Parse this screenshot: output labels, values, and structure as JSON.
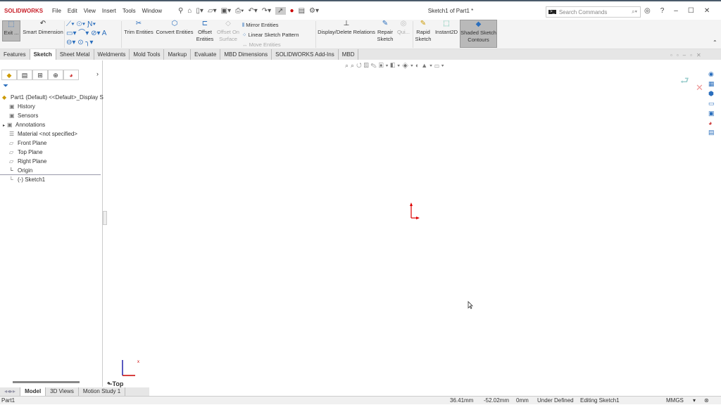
{
  "app": {
    "logo": "SOLIDWORKS",
    "title": "Sketch1 of Part1 *"
  },
  "menu": [
    "File",
    "Edit",
    "View",
    "Insert",
    "Tools",
    "Window"
  ],
  "search": {
    "placeholder": "Search Commands"
  },
  "ribbon": {
    "exit": "Exit ...",
    "smart_dimension": "Smart Dimension",
    "trim": "Trim Entities",
    "convert": "Convert Entities",
    "offset": "Offset Entities",
    "offset_surface": "Offset On Surface",
    "mirror": "Mirror Entities",
    "linear_pattern": "Linear Sketch Pattern",
    "move": "Move Entities",
    "relations": "Display/Delete Relations",
    "repair": "Repair Sketch",
    "quick": "Qui...",
    "rapid": "Rapid Sketch",
    "instant2d": "Instant2D",
    "shaded": "Shaded Sketch Contours"
  },
  "tabs": [
    "Features",
    "Sketch",
    "Sheet Metal",
    "Weldments",
    "Mold Tools",
    "Markup",
    "Evaluate",
    "MBD Dimensions",
    "SOLIDWORKS Add-Ins",
    "MBD"
  ],
  "active_tab": "Sketch",
  "tree": {
    "root": "Part1 (Default) <<Default>_Display S",
    "items": [
      "History",
      "Sensors",
      "Annotations",
      "Material <not specified>",
      "Front Plane",
      "Top Plane",
      "Right Plane",
      "Origin",
      "(-) Sketch1"
    ]
  },
  "viewport": {
    "view_label": "Top"
  },
  "bottom_tabs": [
    "Model",
    "3D Views",
    "Motion Study 1"
  ],
  "status": {
    "doc": "Part1",
    "x": "36.41mm",
    "y": "-52.02mm",
    "z": "0mm",
    "state": "Under Defined",
    "mode": "Editing Sketch1",
    "units": "MMGS"
  }
}
